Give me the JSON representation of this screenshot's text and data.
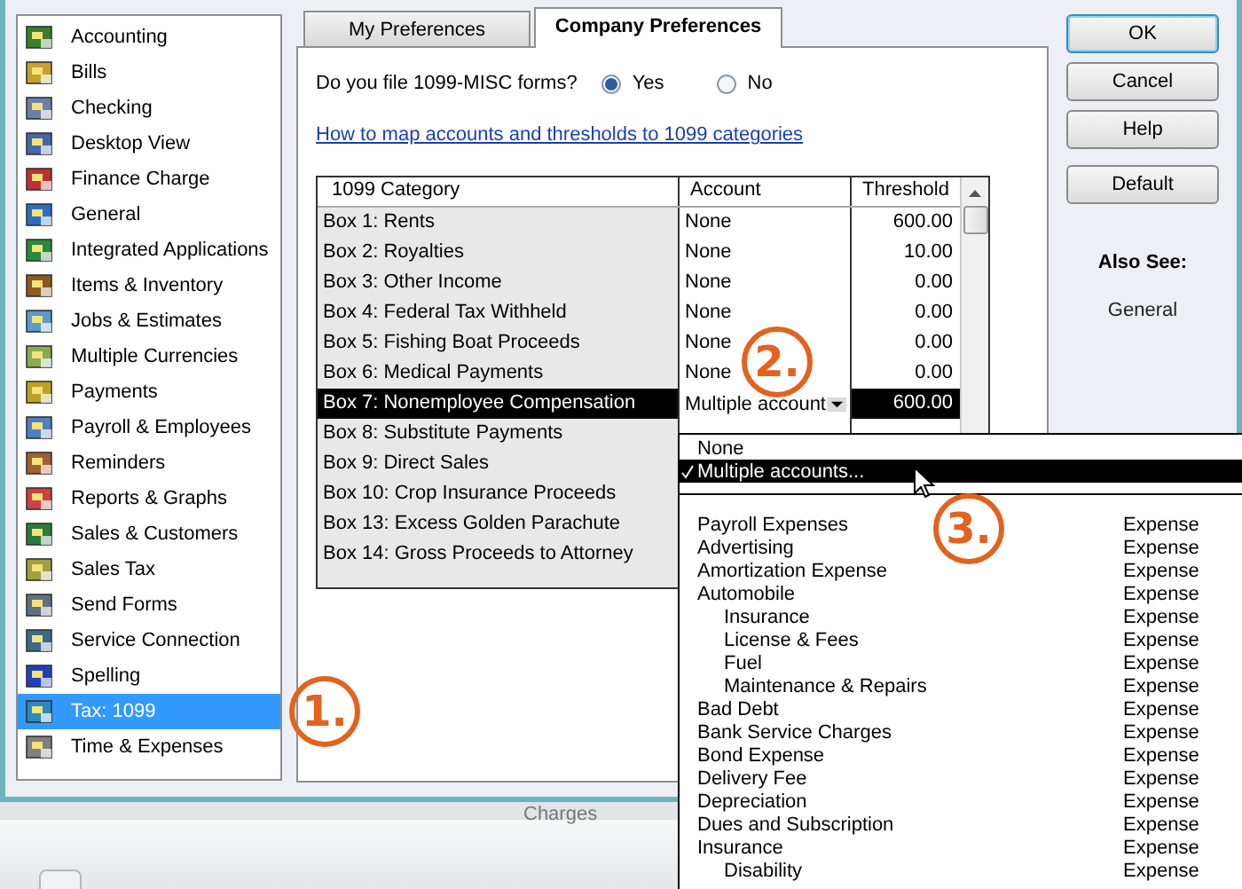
{
  "sidebar": {
    "items": [
      {
        "label": "Accounting",
        "selected": false
      },
      {
        "label": "Bills",
        "selected": false
      },
      {
        "label": "Checking",
        "selected": false
      },
      {
        "label": "Desktop View",
        "selected": false
      },
      {
        "label": "Finance Charge",
        "selected": false
      },
      {
        "label": "General",
        "selected": false
      },
      {
        "label": "Integrated Applications",
        "selected": false
      },
      {
        "label": "Items & Inventory",
        "selected": false
      },
      {
        "label": "Jobs & Estimates",
        "selected": false
      },
      {
        "label": "Multiple Currencies",
        "selected": false
      },
      {
        "label": "Payments",
        "selected": false
      },
      {
        "label": "Payroll & Employees",
        "selected": false
      },
      {
        "label": "Reminders",
        "selected": false
      },
      {
        "label": "Reports & Graphs",
        "selected": false
      },
      {
        "label": "Sales & Customers",
        "selected": false
      },
      {
        "label": "Sales Tax",
        "selected": false
      },
      {
        "label": "Send Forms",
        "selected": false
      },
      {
        "label": "Service Connection",
        "selected": false
      },
      {
        "label": "Spelling",
        "selected": false
      },
      {
        "label": "Tax: 1099",
        "selected": true
      },
      {
        "label": "Time & Expenses",
        "selected": false
      }
    ]
  },
  "tabs": [
    {
      "label": "My Preferences",
      "selected": false
    },
    {
      "label": "Company Preferences",
      "selected": true
    }
  ],
  "question": {
    "label": "Do you file 1099-MISC forms?",
    "options": [
      {
        "label": "Yes",
        "selected": true
      },
      {
        "label": "No",
        "selected": false
      }
    ]
  },
  "help_link": "How to map accounts and thresholds to 1099 categories",
  "table": {
    "columns": [
      "1099 Category",
      "Account",
      "Threshold"
    ],
    "rows": [
      {
        "category": "Box 1: Rents",
        "account": "None",
        "threshold": "600.00",
        "selected": false
      },
      {
        "category": "Box 2: Royalties",
        "account": "None",
        "threshold": "10.00",
        "selected": false
      },
      {
        "category": "Box 3: Other Income",
        "account": "None",
        "threshold": "0.00",
        "selected": false
      },
      {
        "category": "Box 4: Federal Tax Withheld",
        "account": "None",
        "threshold": "0.00",
        "selected": false
      },
      {
        "category": "Box 5: Fishing Boat Proceeds",
        "account": "None",
        "threshold": "0.00",
        "selected": false
      },
      {
        "category": "Box 6: Medical Payments",
        "account": "None",
        "threshold": "0.00",
        "selected": false
      },
      {
        "category": "Box 7: Nonemployee Compensation",
        "account": "Multiple account",
        "threshold": "600.00",
        "selected": true
      },
      {
        "category": "Box 8: Substitute Payments",
        "selected": false
      },
      {
        "category": "Box 9: Direct Sales",
        "selected": false
      },
      {
        "category": "Box 10: Crop Insurance Proceeds",
        "selected": false
      },
      {
        "category": "Box 13: Excess Golden Parachute",
        "selected": false
      },
      {
        "category": "Box 14: Gross Proceeds to Attorney",
        "selected": false
      }
    ]
  },
  "buttons": [
    "OK",
    "Cancel",
    "Help",
    "Default"
  ],
  "also_see": {
    "title": "Also See:",
    "items": [
      "General"
    ]
  },
  "dropdown": {
    "options": [
      {
        "label": "None",
        "selected": false
      },
      {
        "label": "Multiple accounts...",
        "selected": true
      }
    ],
    "accounts": [
      {
        "name": "Payroll Expenses",
        "type": "Expense"
      },
      {
        "name": "Advertising",
        "type": "Expense"
      },
      {
        "name": "Amortization Expense",
        "type": "Expense"
      },
      {
        "name": "Automobile",
        "type": "Expense",
        "children": [
          {
            "name": "Insurance",
            "type": "Expense"
          },
          {
            "name": "License & Fees",
            "type": "Expense"
          },
          {
            "name": "Fuel",
            "type": "Expense"
          },
          {
            "name": "Maintenance & Repairs",
            "type": "Expense"
          }
        ]
      },
      {
        "name": "Bad Debt",
        "type": "Expense"
      },
      {
        "name": "Bank Service Charges",
        "type": "Expense"
      },
      {
        "name": "Bond Expense",
        "type": "Expense"
      },
      {
        "name": "Delivery Fee",
        "type": "Expense"
      },
      {
        "name": "Depreciation",
        "type": "Expense"
      },
      {
        "name": "Dues and Subscription",
        "type": "Expense"
      },
      {
        "name": "Insurance",
        "type": "Expense",
        "children": [
          {
            "name": "Disability",
            "type": "Expense"
          }
        ]
      }
    ]
  },
  "background_window": {
    "text": "Charges"
  },
  "callouts": [
    "1.",
    "2.",
    "3."
  ]
}
